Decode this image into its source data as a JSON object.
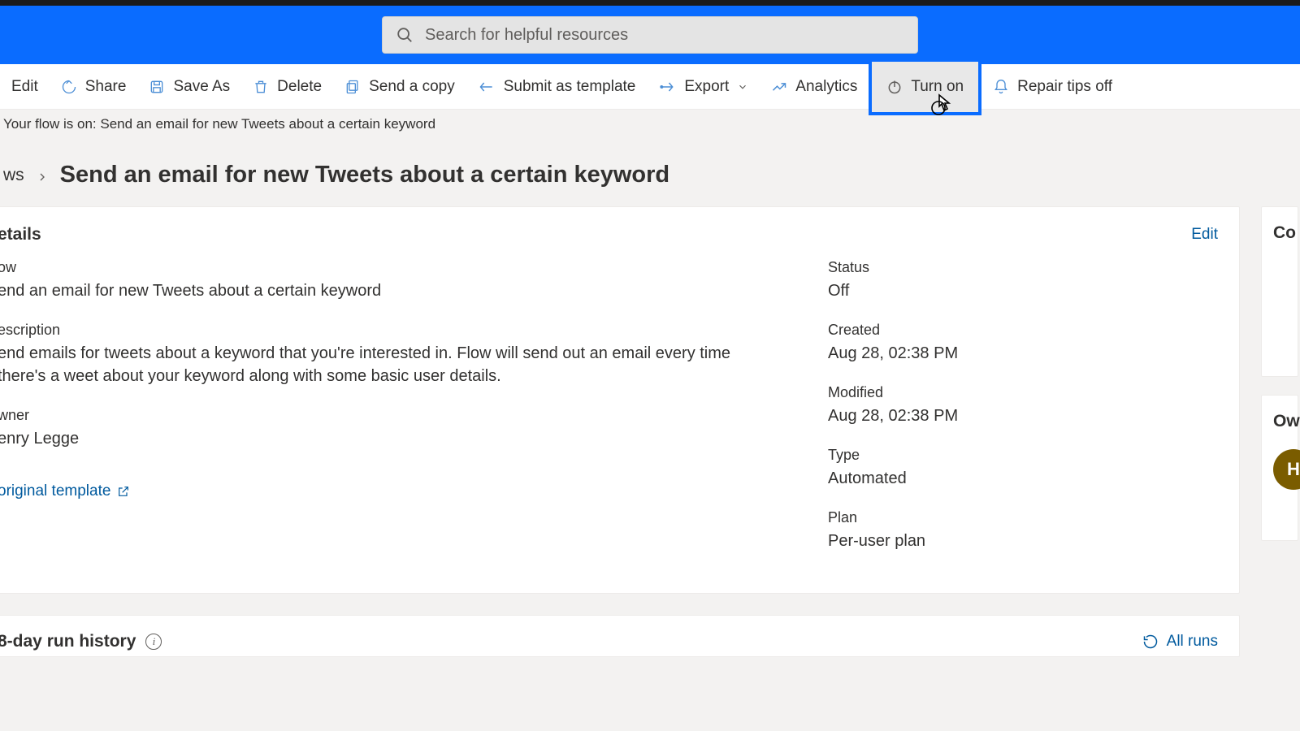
{
  "search": {
    "placeholder": "Search for helpful resources"
  },
  "cmdbar": {
    "edit": "Edit",
    "share": "Share",
    "saveas": "Save As",
    "delete": "Delete",
    "sendcopy": "Send a copy",
    "submit": "Submit as template",
    "export": "Export",
    "analytics": "Analytics",
    "turnon": "Turn on",
    "repair": "Repair tips off"
  },
  "statusline": "Your flow is on: Send an email for new Tweets about a certain keyword",
  "breadcrumb": {
    "root": "ws",
    "title": "Send an email for new Tweets about a certain keyword"
  },
  "details": {
    "section": "etails",
    "edit": "Edit",
    "flow_label": "ow",
    "flow_value": "end an email for new Tweets about a certain keyword",
    "desc_label": "escription",
    "desc_value": "end emails for tweets about a keyword that you're interested in. Flow will send out an email every time there's a weet about your keyword along with some basic user details.",
    "owner_label": "wner",
    "owner_value": "enry Legge",
    "status_label": "Status",
    "status_value": "Off",
    "created_label": "Created",
    "created_value": "Aug 28, 02:38 PM",
    "modified_label": "Modified",
    "modified_value": "Aug 28, 02:38 PM",
    "type_label": "Type",
    "type_value": "Automated",
    "plan_label": "Plan",
    "plan_value": "Per-user plan",
    "orig_link": "original template"
  },
  "side": {
    "connections": "Co",
    "owners": "Ow",
    "avatar": "H"
  },
  "runs": {
    "title": "8-day run history",
    "all": "All runs"
  }
}
